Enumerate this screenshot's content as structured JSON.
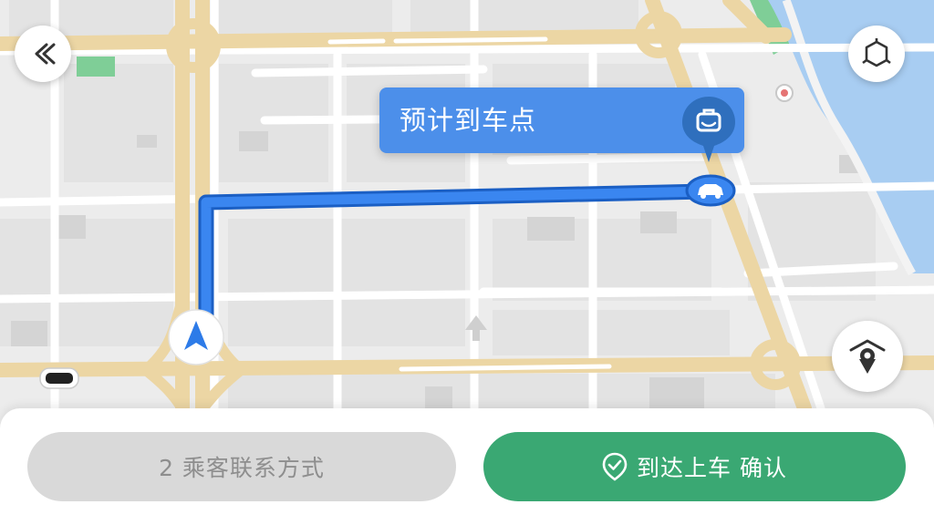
{
  "map": {
    "colors": {
      "background": "#ececec",
      "block": "#e3e3e3",
      "building": "#d6d6d6",
      "road": "#ffffff",
      "main_road": "#ecd6a4",
      "water": "#a8cdf2",
      "park": "#7fce97",
      "route": "#2d7be8",
      "route_outline": "#1b5fc4"
    }
  },
  "header": {
    "back_icon": "back-arrow-icon"
  },
  "pickup_callout": {
    "label": "预计到车点",
    "icon": "luggage-icon",
    "color": "#4c8fea"
  },
  "controls": {
    "top_right_icon": "layers-icon",
    "locate_icon": "driver-locate-icon"
  },
  "actions": {
    "contact_label": "2 乘客联系方式",
    "confirm_label": "到达上车 确认",
    "confirm_icon": "location-check-icon",
    "confirm_color": "#3aa873",
    "contact_color": "#d9d9d9"
  }
}
